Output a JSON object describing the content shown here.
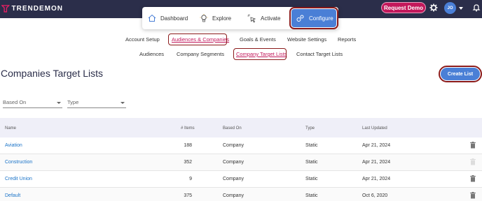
{
  "brand": {
    "name": "TRENDEMON"
  },
  "header": {
    "request_demo": "Request Demo",
    "avatar_initials": "JO"
  },
  "nav": {
    "items": [
      {
        "label": "Dashboard",
        "icon": "home-icon"
      },
      {
        "label": "Explore",
        "icon": "lightbulb-icon"
      },
      {
        "label": "Activate",
        "icon": "cursor-click-icon"
      },
      {
        "label": "Configure",
        "icon": "gears-icon",
        "active": true
      }
    ]
  },
  "subnav": {
    "row1": [
      "Account Setup",
      "Audiences & Companies",
      "Goals & Events",
      "Website Settings",
      "Reports"
    ],
    "row2": [
      "Audiences",
      "Company Segments",
      "Company Target Lists",
      "Contact Target Lists"
    ]
  },
  "page": {
    "title": "Companies Target Lists",
    "create_button": "Create List"
  },
  "filters": {
    "based_on": "Based On",
    "type": "Type"
  },
  "table": {
    "columns": [
      "Name",
      "# Items",
      "Based On",
      "Type",
      "Last Updated"
    ],
    "rows": [
      {
        "name": "Aviation",
        "items": "188",
        "based_on": "Company",
        "type": "Static",
        "updated": "Apr 21, 2024"
      },
      {
        "name": "Construction",
        "items": "352",
        "based_on": "Company",
        "type": "Static",
        "updated": "Apr 21, 2024"
      },
      {
        "name": "Credit Union",
        "items": "9",
        "based_on": "Company",
        "type": "Static",
        "updated": "Apr 21, 2024"
      },
      {
        "name": "Default",
        "items": "375",
        "based_on": "Company",
        "type": "Static",
        "updated": "Oct 6, 2020"
      }
    ]
  },
  "colors": {
    "header_bg": "#2b2e4a",
    "accent_blue": "#4a7fd6",
    "brand_pink": "#c2185b",
    "highlight": "#8b1a1a"
  }
}
